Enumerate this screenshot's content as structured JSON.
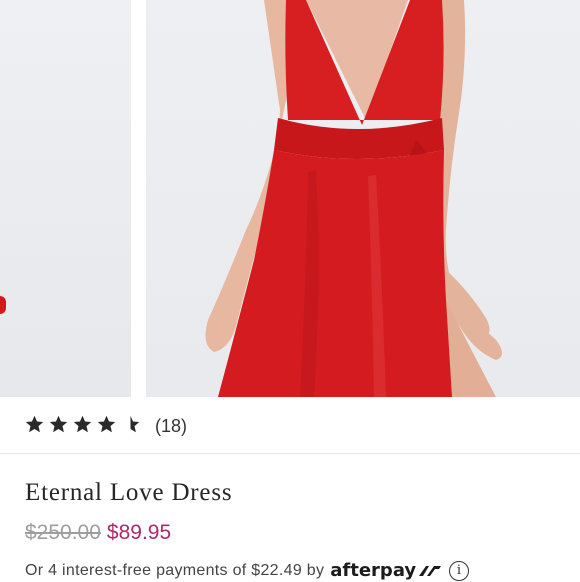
{
  "gallery": {
    "image_left": "product-image-left",
    "image_main": "product-image-main"
  },
  "rating": {
    "value": 4.5,
    "max": 5,
    "count_label": "(18)"
  },
  "product": {
    "title": "Eternal Love Dress",
    "original_price": "$250.00",
    "sale_price": "$89.95"
  },
  "afterpay": {
    "text": "Or 4 interest-free payments of $22.49 by",
    "brand": "afterpay",
    "info_icon": "info-icon"
  },
  "colors": {
    "sale_price": "#b0276b",
    "original_price": "#9e9e9e",
    "dress_red": "#d3191c",
    "star": "#2a2a2a"
  }
}
